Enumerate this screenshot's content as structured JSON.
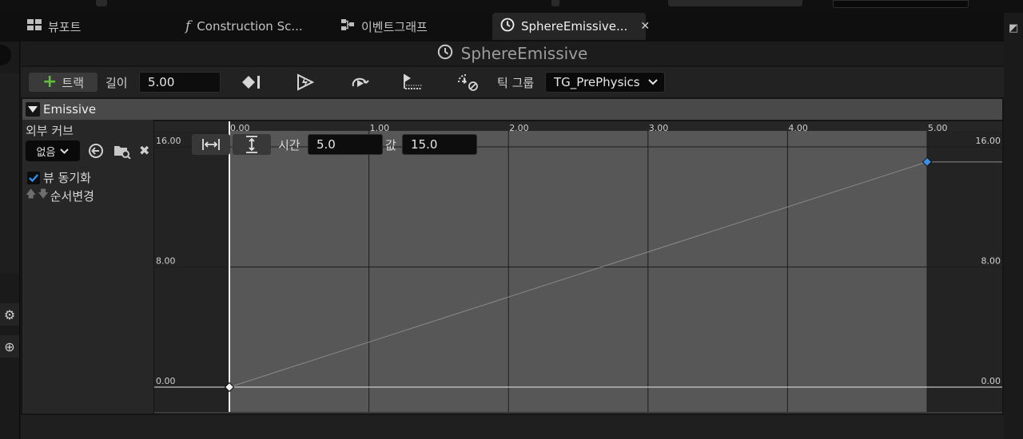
{
  "tabs": [
    {
      "icon": "grid-icon",
      "label": "뷰포트"
    },
    {
      "icon": "function-icon",
      "label": "Construction Sc..."
    },
    {
      "icon": "nodes-icon",
      "label": "이벤트그래프"
    },
    {
      "icon": "clock-icon",
      "label": "SphereEmissive...",
      "active": true
    }
  ],
  "title": "SphereEmissive",
  "toolbar": {
    "add_track_label": "트랙",
    "length_label": "길이",
    "length_value": "5.00",
    "tick_group_label": "틱 그룹",
    "tick_group_value": "TG_PrePhysics",
    "icons": [
      "add-key-icon",
      "autoplay-icon",
      "loop-icon",
      "replicated-icon",
      "ignore-time-dilation-icon"
    ]
  },
  "track": {
    "name": "Emissive",
    "external_curve_label": "외부 커브",
    "external_curve_value": "없음",
    "sync_view_label": "뷰 동기화",
    "sync_view_checked": true,
    "reorder_label": "순서변경"
  },
  "key_editor": {
    "time_label": "시간",
    "time_value": "5.0",
    "value_label": "값",
    "value_value": "15.0"
  },
  "chart_data": {
    "type": "line",
    "x_ticks": [
      "0.00",
      "1.00",
      "2.00",
      "3.00",
      "4.00",
      "5.00"
    ],
    "y_ticks_left": [
      "16.00",
      "8.00",
      "0.00"
    ],
    "y_ticks_right": [
      "16.00",
      "8.00",
      "0.00"
    ],
    "xlim": [
      0,
      6.25
    ],
    "ylim": [
      -2,
      18
    ],
    "keys": [
      {
        "x": 0,
        "y": 0,
        "selected": false
      },
      {
        "x": 5,
        "y": 15,
        "selected": true
      }
    ],
    "colors": {
      "active_region": "#575757",
      "outside_region": "#232323",
      "curve": "#8a8a8a",
      "selected_key": "#3b8fe6",
      "key": "#f2f2f2"
    }
  }
}
